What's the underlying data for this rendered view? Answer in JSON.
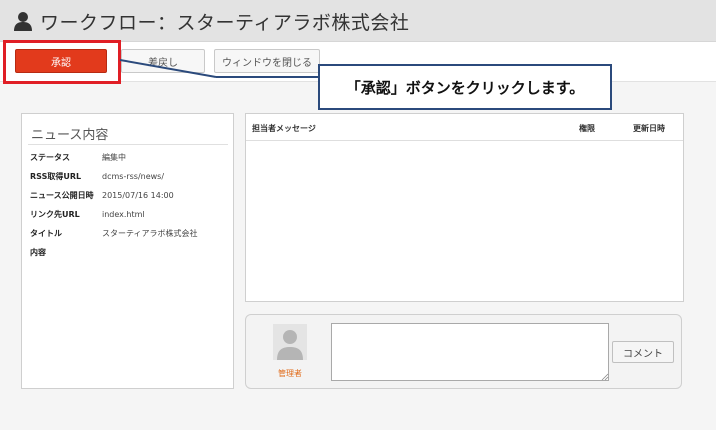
{
  "header": {
    "title": "ワークフロー：スターティアラボ株式会社"
  },
  "toolbar": {
    "approve_label": "承認",
    "reject_label": "差戻し",
    "close_label": "ウィンドウを閉じる"
  },
  "callout": {
    "text": "「承認」ボタンをクリックします。"
  },
  "news": {
    "title": "ニュース内容",
    "fields": [
      {
        "label": "ステータス",
        "value": "編集中"
      },
      {
        "label": "RSS取得URL",
        "value": "dcms-rss/news/"
      },
      {
        "label": "ニュース公開日時",
        "value": "2015/07/16 14:00"
      },
      {
        "label": "リンク先URL",
        "value": "index.html"
      },
      {
        "label": "タイトル",
        "value": "スターティアラボ株式会社"
      },
      {
        "label": "内容",
        "value": ""
      }
    ]
  },
  "messages": {
    "columns": [
      "担当者メッセージ",
      "権限",
      "更新日時"
    ]
  },
  "comment": {
    "user_name": "管理者",
    "button_label": "コメント",
    "value": ""
  },
  "colors": {
    "accent": "#e23a1c",
    "highlight": "#e01e25",
    "callout_border": "#2b4a7c"
  }
}
